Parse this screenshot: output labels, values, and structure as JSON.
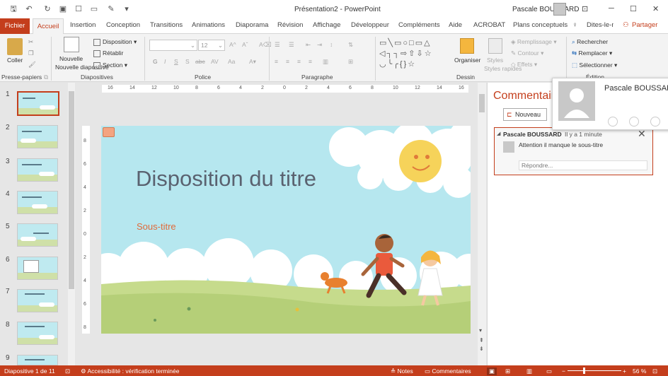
{
  "app": {
    "doc_title": "Présentation2 - PowerPoint",
    "user_name": "Pascale BOUSSARD"
  },
  "tabs": [
    "Fichier",
    "Accueil",
    "Insertion",
    "Conception",
    "Transitions",
    "Animations",
    "Diaporama",
    "Révision",
    "Affichage",
    "Développeur",
    "Compléments",
    "Aide",
    "ACROBAT",
    "Plans conceptuels",
    "Dites-le-nous",
    "Partager"
  ],
  "ribbon": {
    "paste": "Coller",
    "new_slide": "Nouvelle diapositive",
    "layout": "Disposition",
    "reset": "Rétablir",
    "section": "Section",
    "font_size": "12",
    "arrange": "Organiser",
    "styles": "Styles rapides",
    "fill": "Remplissage",
    "outline": "Contour",
    "effects": "Effets",
    "find": "Rechercher",
    "replace": "Remplacer",
    "select": "Sélectionner",
    "groups": {
      "clipboard": "Presse-papiers",
      "slides": "Diapositives",
      "font": "Police",
      "paragraph": "Paragraphe",
      "drawing": "Dessin",
      "editing": "Édition"
    }
  },
  "thumbnails": [
    "1",
    "2",
    "3",
    "4",
    "5",
    "6",
    "7",
    "8",
    "9"
  ],
  "ruler_h": [
    "16",
    "14",
    "12",
    "10",
    "8",
    "6",
    "4",
    "2",
    "0",
    "2",
    "4",
    "6",
    "8",
    "10",
    "12",
    "14",
    "16"
  ],
  "ruler_v": [
    "8",
    "6",
    "4",
    "2",
    "0",
    "2",
    "4",
    "6",
    "8"
  ],
  "slide": {
    "title": "Disposition du titre",
    "subtitle": "Sous-titre"
  },
  "comments": {
    "pane_title": "Commentaires",
    "new_button": "Nouveau",
    "author": "Pascale BOUSSARD",
    "time": "Il y a 1 minute",
    "text": "Attention il manque le sous-titre",
    "reply_placeholder": "Répondre..."
  },
  "card": {
    "name": "Pascale BOUSSARD"
  },
  "status": {
    "slide_info": "Diapositive 1 de 11",
    "accessibility": "Accessibilité : vérification terminée",
    "notes": "Notes",
    "comments": "Commentaires",
    "zoom": "56 %"
  },
  "colors": {
    "accent": "#c43e1c",
    "slide_bg": "#b6e7ef",
    "title": "#5a6270",
    "subtitle": "#e06a3a"
  }
}
